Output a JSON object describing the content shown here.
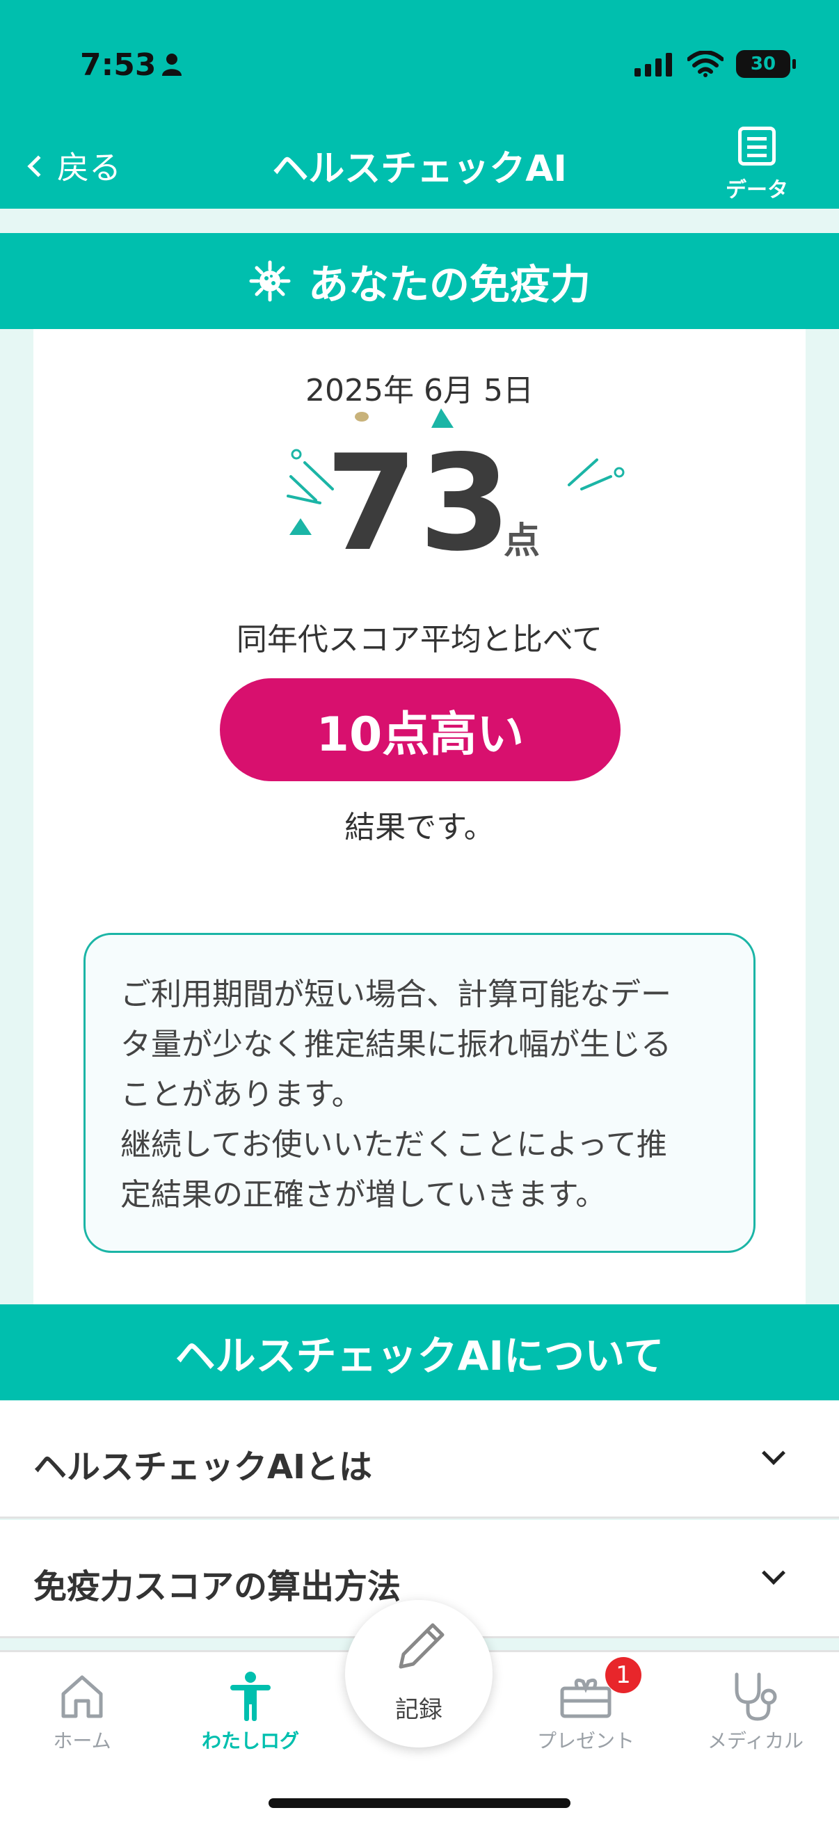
{
  "status_bar": {
    "time": "7:53",
    "battery": "30"
  },
  "header": {
    "back_label": "戻る",
    "title": "ヘルスチェックAI",
    "data_label": "データ"
  },
  "section_immunity": {
    "title": "あなたの免疫力",
    "date": "2025年 6月 5日",
    "score": "73",
    "score_unit": "点",
    "compare_text": "同年代スコア平均と比べて",
    "compare_result": "10点高い",
    "result_suffix": "結果です。",
    "note_lines": [
      "ご利用期間が短い場合、計算可能なデー",
      "タ量が少なく推定結果に振れ幅が生じる",
      "ことがあります。",
      "継続してお使いいただくことによって推",
      "定結果の正確さが増していきます。"
    ]
  },
  "section_about": {
    "title": "ヘルスチェックAIについて",
    "items": [
      {
        "label": "ヘルスチェックAIとは"
      },
      {
        "label": "免疫力スコアの算出方法"
      }
    ]
  },
  "tabbar": {
    "tabs": [
      {
        "label": "ホーム",
        "icon": "home-icon"
      },
      {
        "label": "わたしログ",
        "icon": "person-icon",
        "active": true
      },
      {
        "label": "記録",
        "icon": "pencil-icon"
      },
      {
        "label": "プレゼント",
        "icon": "gift-icon",
        "badge": "1"
      },
      {
        "label": "メディカル",
        "icon": "stethoscope-icon"
      }
    ]
  },
  "colors": {
    "accent": "#00bfae",
    "highlight": "#d8106e",
    "badge": "#e8262b"
  }
}
